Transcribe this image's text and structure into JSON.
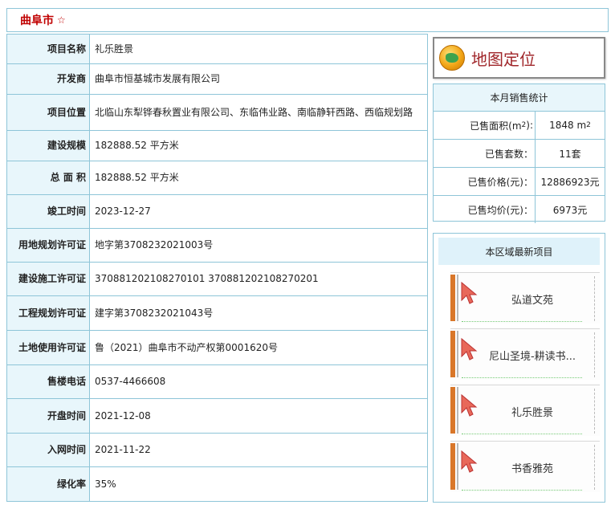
{
  "header": {
    "city": "曲阜市",
    "star": "☆"
  },
  "info": [
    {
      "label": "项目名称",
      "value": "礼乐胜景"
    },
    {
      "label": "开发商",
      "value": "曲阜市恒基城市发展有限公司"
    },
    {
      "label": "项目位置",
      "value": "北临山东犁铧春秋置业有限公司、东临伟业路、南临静轩西路、西临规划路"
    },
    {
      "label": "建设规模",
      "value": "182888.52 平方米"
    },
    {
      "label": "总 面 积",
      "value": "182888.52 平方米"
    },
    {
      "label": "竣工时间",
      "value": "2023-12-27"
    },
    {
      "label": "用地规划许可证",
      "value": "地字第3708232021003号"
    },
    {
      "label": "建设施工许可证",
      "value": "370881202108270101 370881202108270201"
    },
    {
      "label": "工程规划许可证",
      "value": "建字第3708232021043号"
    },
    {
      "label": "土地使用许可证",
      "value": "鲁（2021）曲阜市不动产权第0001620号"
    },
    {
      "label": "售楼电话",
      "value": "0537-4466608"
    },
    {
      "label": "开盘时间",
      "value": "2021-12-08"
    },
    {
      "label": "入网时间",
      "value": "2021-11-22"
    },
    {
      "label": "绿化率",
      "value": "35%"
    }
  ],
  "map_button": {
    "label": "地图定位",
    "icon": "globe-icon"
  },
  "sales": {
    "title": "本月销售统计",
    "area_label": "已售面积(m",
    "area_sup": "2",
    "area_label_end": "):",
    "area_value": "1848 m",
    "area_value_sup": "2",
    "count_label": "已售套数：",
    "count_value": "11套",
    "price_label": "已售价格(元)：",
    "price_value": "12886923元",
    "avg_label": "已售均价(元)：",
    "avg_value": "6973元"
  },
  "latest": {
    "title": "本区域最新项目",
    "projects": [
      "弘道文苑",
      "尼山圣境-耕读书...",
      "礼乐胜景",
      "书香雅苑"
    ]
  }
}
